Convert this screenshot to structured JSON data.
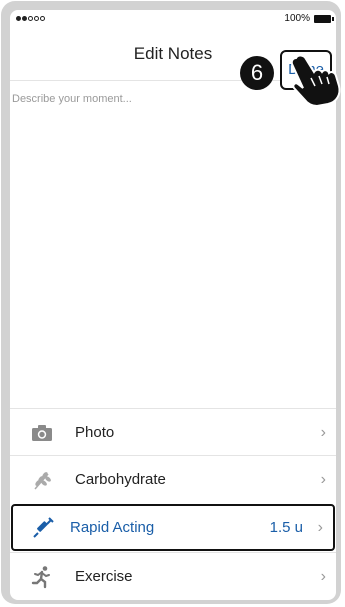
{
  "status": {
    "battery": "100%"
  },
  "nav": {
    "title": "Edit Notes",
    "step": "6",
    "done": "Done"
  },
  "note": {
    "placeholder": "Describe your moment..."
  },
  "items": [
    {
      "label": "Photo",
      "icon": "camera-icon"
    },
    {
      "label": "Carbohydrate",
      "icon": "wheat-icon"
    },
    {
      "label": "Rapid Acting",
      "icon": "syringe-icon",
      "value": "1.5 u"
    },
    {
      "label": "Exercise",
      "icon": "running-icon"
    }
  ],
  "colors": {
    "accent": "#1a5ea8",
    "frame": "#d2d2d2",
    "highlight": "#111111"
  }
}
